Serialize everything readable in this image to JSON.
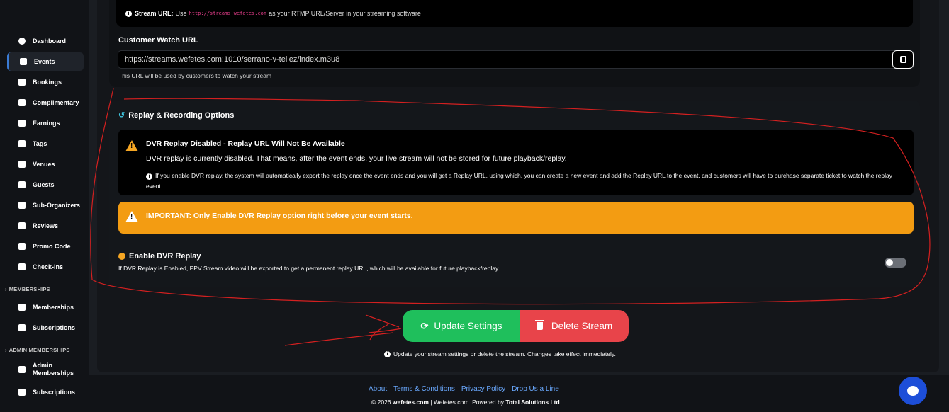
{
  "sidebar": {
    "items": [
      {
        "label": "Dashboard",
        "icon": "dashboard-icon"
      },
      {
        "label": "Events",
        "icon": "calendar-icon"
      },
      {
        "label": "Bookings",
        "icon": "ticket-icon"
      },
      {
        "label": "Complimentary",
        "icon": "gift-icon"
      },
      {
        "label": "Earnings",
        "icon": "wallet-icon"
      },
      {
        "label": "Tags",
        "icon": "tags-icon"
      },
      {
        "label": "Venues",
        "icon": "venue-icon"
      },
      {
        "label": "Guests",
        "icon": "guests-icon"
      },
      {
        "label": "Sub-Organizers",
        "icon": "users-icon"
      },
      {
        "label": "Reviews",
        "icon": "star-icon"
      },
      {
        "label": "Promo Code",
        "icon": "tag-icon"
      },
      {
        "label": "Check-Ins",
        "icon": "building-icon"
      }
    ],
    "section_memberships": "MEMBERSHIPS",
    "memberships_items": [
      {
        "label": "Memberships",
        "icon": "book-icon"
      },
      {
        "label": "Subscriptions",
        "icon": "book-icon"
      }
    ],
    "section_admin": "ADMIN MEMBERSHIPS",
    "admin_items": [
      {
        "label": "Admin Memberships",
        "icon": "book-icon"
      },
      {
        "label": "Subscriptions",
        "icon": "book-icon"
      }
    ]
  },
  "stream": {
    "url_label": "Stream URL:",
    "url_pre": "Use",
    "url_code": "http://streams.wefetes.com",
    "url_post": "as your RTMP URL/Server in your streaming software"
  },
  "watch": {
    "label": "Customer Watch URL",
    "value": "https://streams.wefetes.com:1010/serrano-v-tellez/index.m3u8",
    "hint": "This URL will be used by customers to watch your stream"
  },
  "replay": {
    "title": "Replay & Recording Options",
    "dvr_heading": "DVR Replay Disabled - Replay URL Will Not Be Available",
    "dvr_text": "DVR replay is currently disabled. That means, after the event ends, your live stream will not be stored for future playback/replay.",
    "dvr_note": "If you enable DVR replay, the system will automatically export the replay once the event ends and you will get a Replay URL, using which, you can create a new event and add the Replay URL to the event, and customers will have to purchase separate ticket to watch the replay event.",
    "important": "IMPORTANT: Only Enable DVR Replay option right before your event starts.",
    "enable_label": "Enable DVR Replay",
    "enable_hint": "If DVR Replay is Enabled, PPV Stream video will be exported to get a permanent replay URL, which will be available for future playback/replay.",
    "enabled": false
  },
  "actions": {
    "update": "Update Settings",
    "delete": "Delete Stream",
    "hint": "Update your stream settings or delete the stream. Changes take effect immediately."
  },
  "footer": {
    "links": [
      "About",
      "Terms & Conditions",
      "Privacy Policy",
      "Drop Us a Line"
    ],
    "copy_pre": "© 2026",
    "copy_site": "wefetes.com",
    "copy_mid": "| Wefetes.com. Powered by",
    "copy_company": "Total Solutions Ltd"
  },
  "colors": {
    "accent_blue": "#3a7bd5",
    "success": "#1fbf5c",
    "danger": "#e8444a",
    "warning": "#f39c12",
    "annotation_red": "#d42020"
  }
}
